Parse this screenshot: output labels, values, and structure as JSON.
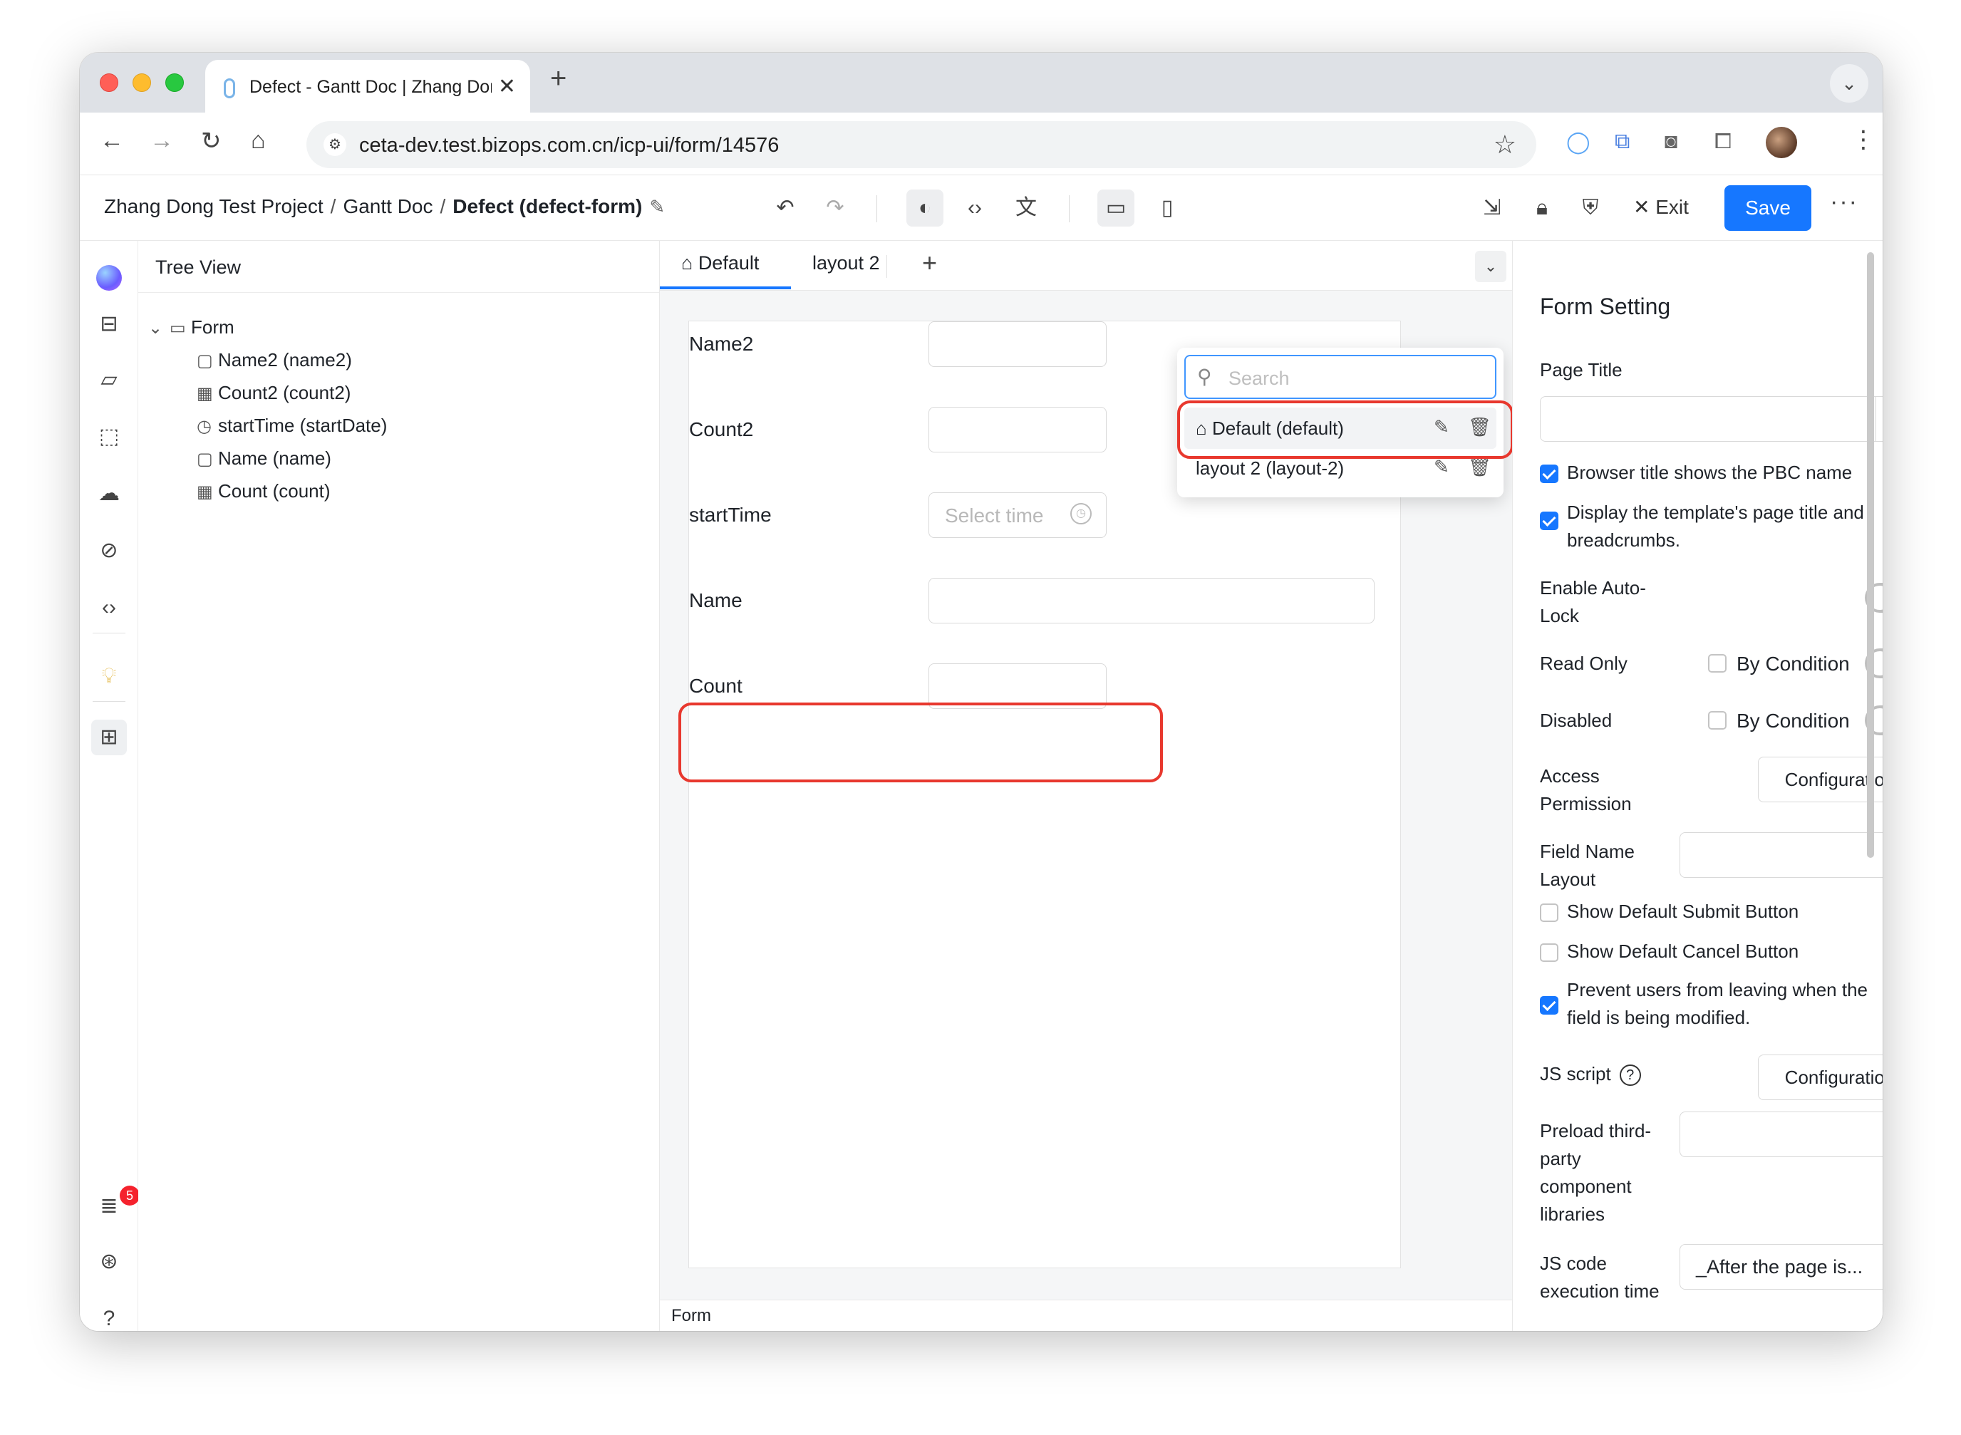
{
  "browser": {
    "tab_title": "Defect - Gantt Doc | Zhang Dong",
    "url": "ceta-dev.test.bizops.com.cn/icp-ui/form/14576"
  },
  "header": {
    "crumb_project": "Zhang Dong Test Project",
    "crumb_doc": "Gantt Doc",
    "crumb_current": "Defect (defect-form)",
    "exit_label": "Exit",
    "save_label": "Save"
  },
  "rail": {
    "badge_count": "5"
  },
  "tree": {
    "title": "Tree View",
    "root": "Form",
    "items": [
      {
        "icon": "input-icon",
        "label": "Name2 (name2)"
      },
      {
        "icon": "number-icon",
        "label": "Count2 (count2)"
      },
      {
        "icon": "clock-icon",
        "label": "startTime (startDate)"
      },
      {
        "icon": "input-icon",
        "label": "Name (name)"
      },
      {
        "icon": "number-icon",
        "label": "Count (count)"
      }
    ]
  },
  "canvas": {
    "tabs": [
      "Default",
      "layout 2"
    ],
    "fields": [
      {
        "label": "Name2"
      },
      {
        "label": "Count2"
      },
      {
        "label": "startTime",
        "placeholder": "Select time"
      },
      {
        "label": "Name"
      },
      {
        "label": "Count"
      }
    ],
    "status": "Form"
  },
  "dropdown": {
    "search_placeholder": "Search",
    "items": [
      "Default (default)",
      "layout 2 (layout-2)"
    ]
  },
  "settings": {
    "title": "Form Setting",
    "page_title_label": "Page Title",
    "browser_title_pbc": "Browser title shows the PBC name",
    "display_template_1": "Display the template's page title and",
    "display_template_2": "breadcrumbs.",
    "auto_lock_1": "Enable Auto-",
    "auto_lock_2": "Lock",
    "read_only": "Read Only",
    "by_condition": "By Condition",
    "disabled": "Disabled",
    "access_1": "Access",
    "access_2": "Permission",
    "configuration": "Configuration",
    "field_name_1": "Field Name",
    "field_name_2": "Layout",
    "show_submit": "Show Default Submit Button",
    "show_cancel": "Show Default Cancel Button",
    "prevent_1": "Prevent users from leaving when the",
    "prevent_2": "field is being modified.",
    "js_script": "JS script",
    "preload_1": "Preload third-",
    "preload_2": "party",
    "preload_3": "component",
    "preload_4": "libraries",
    "js_exec_1": "JS code",
    "js_exec_2": "execution time",
    "js_exec_value": "_After the page is..."
  }
}
